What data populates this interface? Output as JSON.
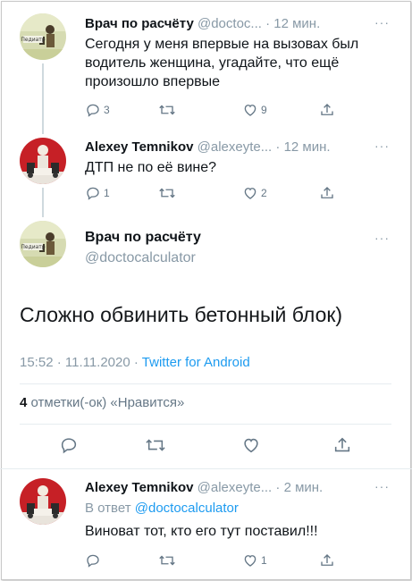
{
  "tweet1": {
    "name": "Врач по расчёту",
    "handle": "@doctoc...",
    "time": "· 12 мин.",
    "text": "Сегодня у меня впервые на вызовах был водитель женщина, угадайте, что ещё произошло впервые",
    "replies": "3",
    "retweets": "",
    "likes": "9"
  },
  "tweet2": {
    "name": "Alexey Temnikov",
    "handle": "@alexeyte...",
    "time": "· 12 мин.",
    "text": "ДТП не по её вине?",
    "replies": "1",
    "retweets": "",
    "likes": "2"
  },
  "main": {
    "name": "Врач по расчёту",
    "handle": "@doctocalculator",
    "text": "Сложно обвинить бетонный блок)",
    "date": "15:52 · 11.11.2020 · ",
    "source": "Twitter for Android",
    "likes_count": "4",
    "likes_label": " отметки(-ок) «Нравится»"
  },
  "tweet3": {
    "name": "Alexey Temnikov",
    "handle": "@alexeyte...",
    "time": "· 2 мин.",
    "reply_prefix": "В ответ ",
    "reply_handle": "@doctocalculator",
    "text": "Виноват тот, кто его тут поставил!!!",
    "replies": "",
    "retweets": "",
    "likes": "1"
  },
  "more_label": "···",
  "avatar_caption": "Педиатр",
  "colors": {
    "link": "#1d9bf0",
    "muted": "#8899a6",
    "icon": "#657786"
  }
}
